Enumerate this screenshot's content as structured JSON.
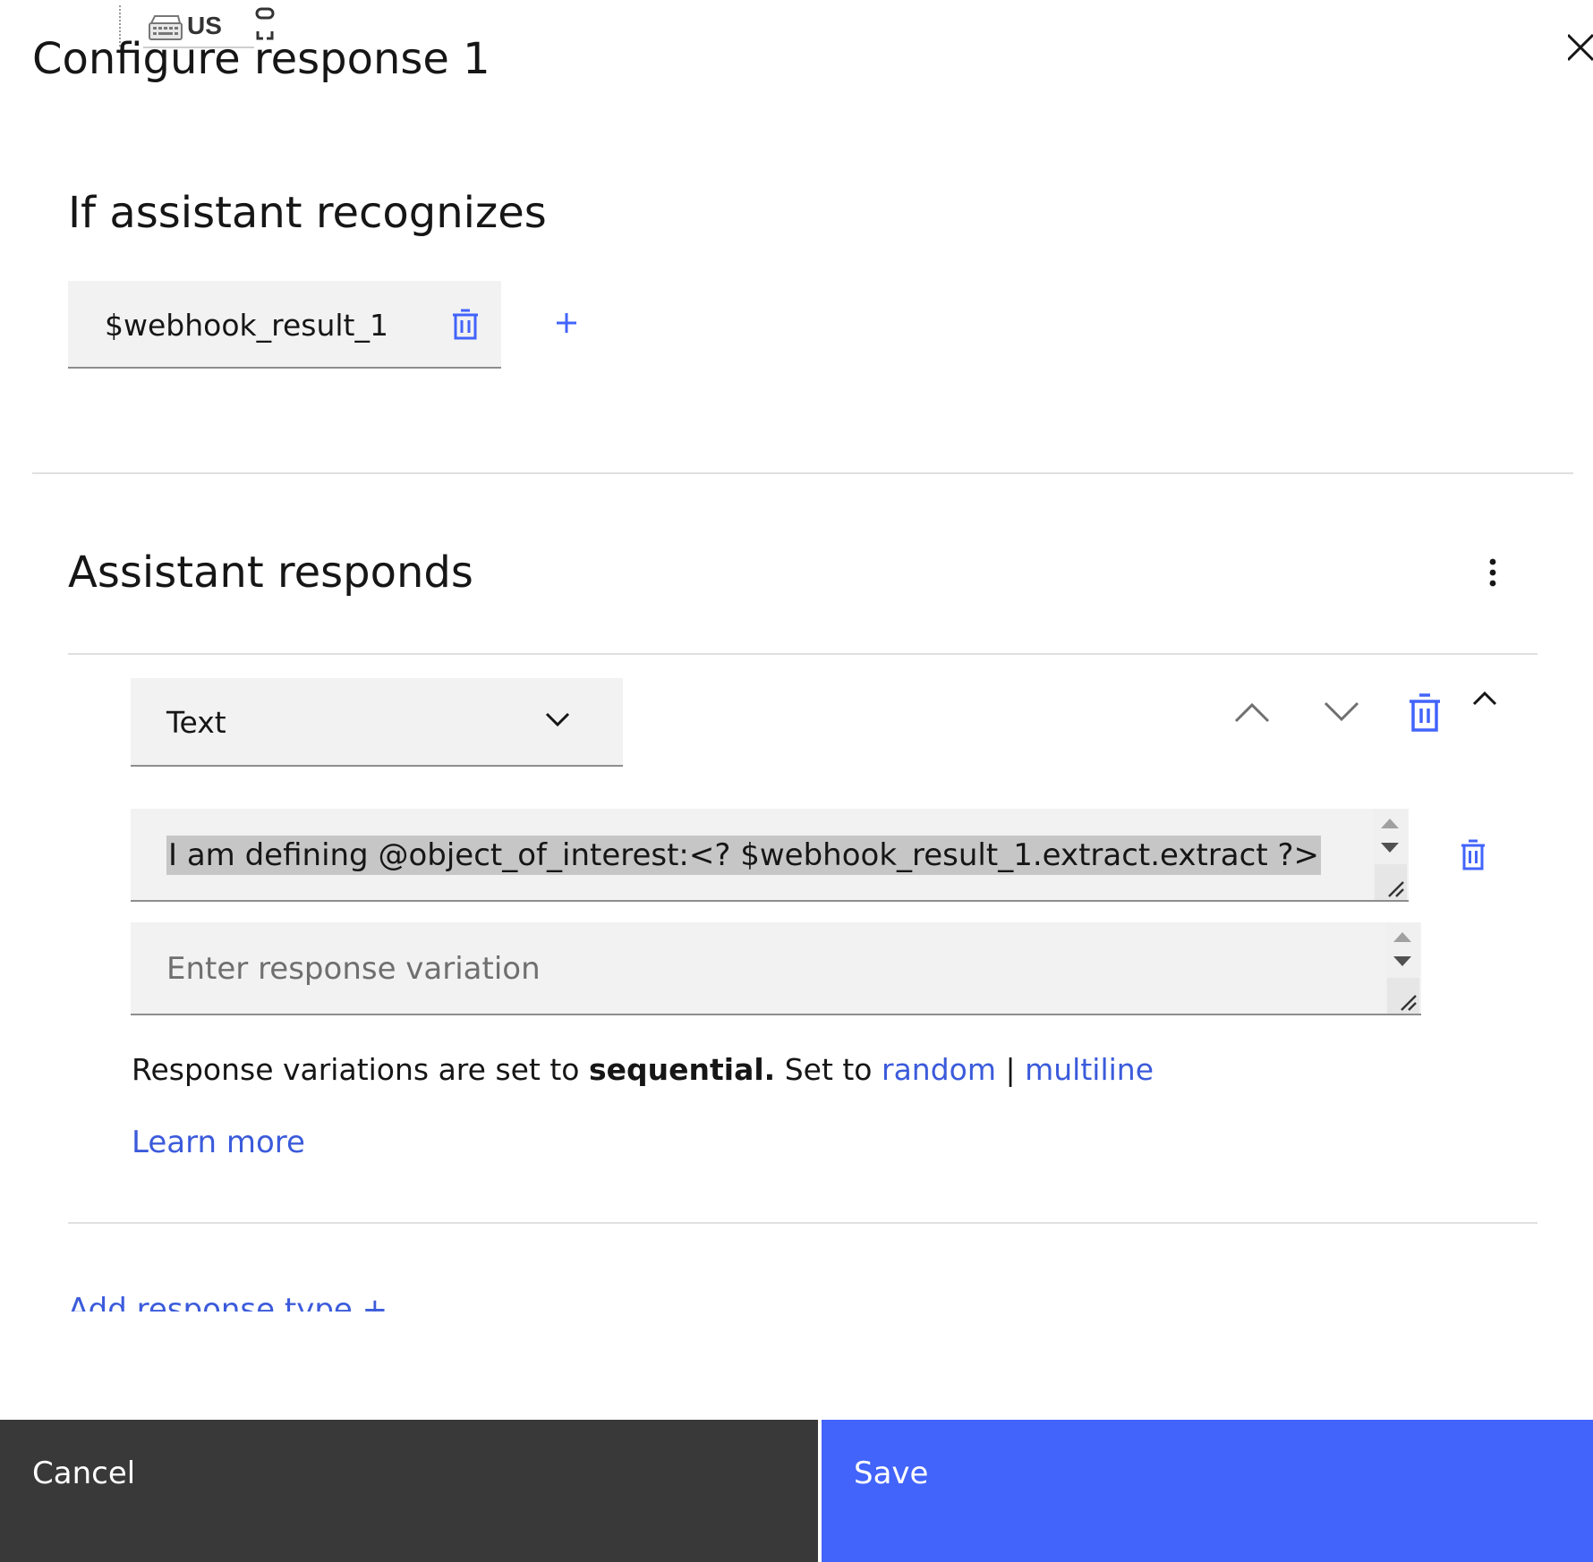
{
  "ime": {
    "language": "US"
  },
  "panel": {
    "title": "Configure response 1"
  },
  "condition_section": {
    "heading": "If assistant recognizes",
    "condition_value": "$webhook_result_1"
  },
  "response_section": {
    "heading": "Assistant responds",
    "response_type": {
      "selected": "Text"
    },
    "variations": [
      {
        "value": "I am defining @object_of_interest:<? $webhook_result_1.extract.extract ?>"
      }
    ],
    "new_variation_placeholder": "Enter response variation",
    "variation_mode": {
      "prefix": "Response variations are set to ",
      "current": "sequential.",
      "set_to": " Set to ",
      "option_random": "random",
      "separator": " | ",
      "option_multiline": "multiline"
    },
    "learn_more": "Learn more",
    "add_response_type": "Add response type +"
  },
  "footer": {
    "cancel_label": "Cancel",
    "save_label": "Save"
  },
  "colors": {
    "primary": "#4264fb",
    "link": "#3b5bdb",
    "footer_dark": "#393939",
    "field_bg": "#f2f2f2"
  }
}
